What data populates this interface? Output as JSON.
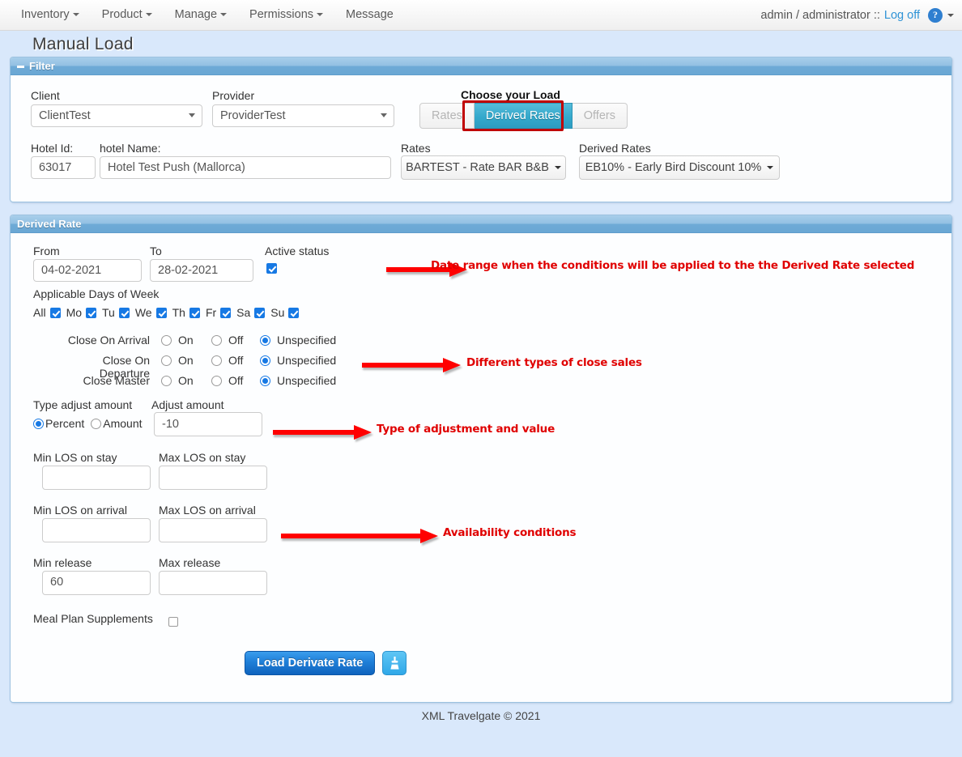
{
  "navbar": {
    "items": [
      {
        "label": "Inventory",
        "caret": true
      },
      {
        "label": "Product",
        "caret": true
      },
      {
        "label": "Manage",
        "caret": true
      },
      {
        "label": "Permissions",
        "caret": true
      },
      {
        "label": "Message",
        "caret": false
      }
    ],
    "user": "admin / administrator ::",
    "logoff": "Log off",
    "help_glyph": "?"
  },
  "page": {
    "title": "Manual Load",
    "footer": "XML Travelgate © 2021"
  },
  "filter": {
    "panel_title": "Filter",
    "client_label": "Client",
    "client_value": "ClientTest",
    "provider_label": "Provider",
    "provider_value": "ProviderTest",
    "choose_load_label": "Choose your Load",
    "load_options": [
      "Rates",
      "Derived Rates",
      "Offers"
    ],
    "load_selected": "Derived Rates",
    "hotel_id_label": "Hotel Id:",
    "hotel_id_value": "63017",
    "hotel_name_label": "hotel Name:",
    "hotel_name_value": "Hotel Test Push (Mallorca)",
    "rates_label": "Rates",
    "rates_value": "BARTEST - Rate BAR B&B",
    "derived_rates_label": "Derived Rates",
    "derived_rates_value": "EB10% - Early Bird Discount 10%"
  },
  "derived_rate": {
    "panel_title": "Derived Rate",
    "from_label": "From",
    "from_value": "04-02-2021",
    "to_label": "To",
    "to_value": "28-02-2021",
    "active_status_label": "Active status",
    "active_status_checked": true,
    "days_label": "Applicable Days of Week",
    "days": [
      {
        "label": "All",
        "checked": true
      },
      {
        "label": "Mo",
        "checked": true
      },
      {
        "label": "Tu",
        "checked": true
      },
      {
        "label": "We",
        "checked": true
      },
      {
        "label": "Th",
        "checked": true
      },
      {
        "label": "Fr",
        "checked": true
      },
      {
        "label": "Sa",
        "checked": true
      },
      {
        "label": "Su",
        "checked": true
      }
    ],
    "close_rows": [
      {
        "label": "Close On Arrival",
        "selected": "Unspecified"
      },
      {
        "label": "Close On Departure",
        "selected": "Unspecified"
      },
      {
        "label": "Close Master",
        "selected": "Unspecified"
      }
    ],
    "close_options": [
      "On",
      "Off",
      "Unspecified"
    ],
    "type_adjust_label": "Type adjust amount",
    "type_percent": "Percent",
    "type_amount": "Amount",
    "type_selected": "Percent",
    "adjust_amount_label": "Adjust amount",
    "adjust_amount_value": "-10",
    "min_los_stay_label": "Min LOS on stay",
    "min_los_stay_value": "",
    "max_los_stay_label": "Max LOS on stay",
    "max_los_stay_value": "",
    "min_los_arrival_label": "Min LOS on arrival",
    "min_los_arrival_value": "",
    "max_los_arrival_label": "Max LOS on arrival",
    "max_los_arrival_value": "",
    "min_release_label": "Min release",
    "min_release_value": "60",
    "max_release_label": "Max release",
    "max_release_value": "",
    "meal_plan_label": "Meal Plan Supplements",
    "meal_plan_checked": false,
    "submit_label": "Load Derivate Rate",
    "clear_icon": "broom-icon"
  },
  "annotations": [
    {
      "text": "Date range when the conditions will be applied to the the Derived Rate selected"
    },
    {
      "text": "Different types of close sales"
    },
    {
      "text": "Type of adjustment and value"
    },
    {
      "text": "Availability conditions"
    }
  ],
  "colors": {
    "accent_blue": "#2f93d6",
    "panel_header": "#6eaad6",
    "page_bg": "#d9e8fb",
    "annotation_red": "#e00000",
    "active_segment": "#35a9cc",
    "highlight_border": "#c00000"
  }
}
